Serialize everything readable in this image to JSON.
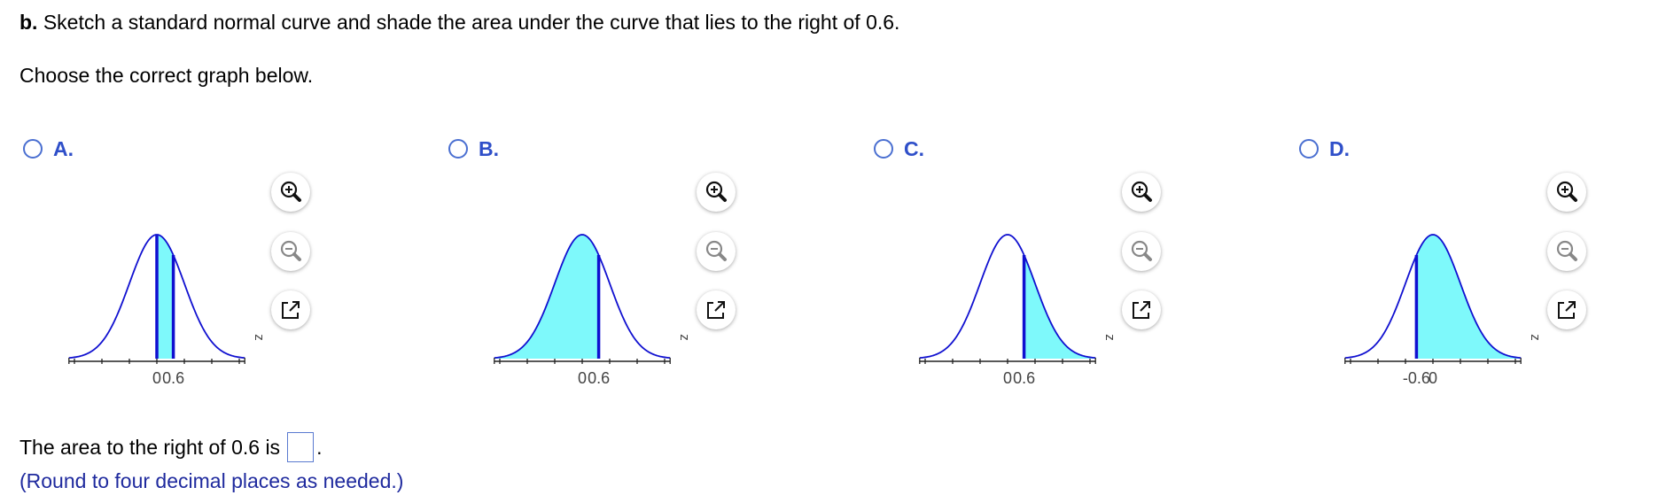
{
  "question": {
    "part_label": "b.",
    "prompt": "Sketch a standard normal curve and shade the area under the curve that lies to the right of 0.6.",
    "instruction": "Choose the correct graph below."
  },
  "options": [
    {
      "letter": "A.",
      "tick_labels": [
        "0",
        "0.6"
      ],
      "axis_label": "z"
    },
    {
      "letter": "B.",
      "tick_labels": [
        "0",
        "0.6"
      ],
      "axis_label": "z"
    },
    {
      "letter": "C.",
      "tick_labels": [
        "0",
        "0.6"
      ],
      "axis_label": "z"
    },
    {
      "letter": "D.",
      "tick_labels": [
        "-0.6",
        "0"
      ],
      "axis_label": "z"
    }
  ],
  "answer": {
    "prefix": "The area to the right of 0.6 is",
    "value": "",
    "suffix": ".",
    "hint": "(Round to four decimal places as needed.)"
  },
  "colors": {
    "accent": "#2f4fc9",
    "curve": "#1010d0",
    "shade": "#7ef9fb"
  }
}
